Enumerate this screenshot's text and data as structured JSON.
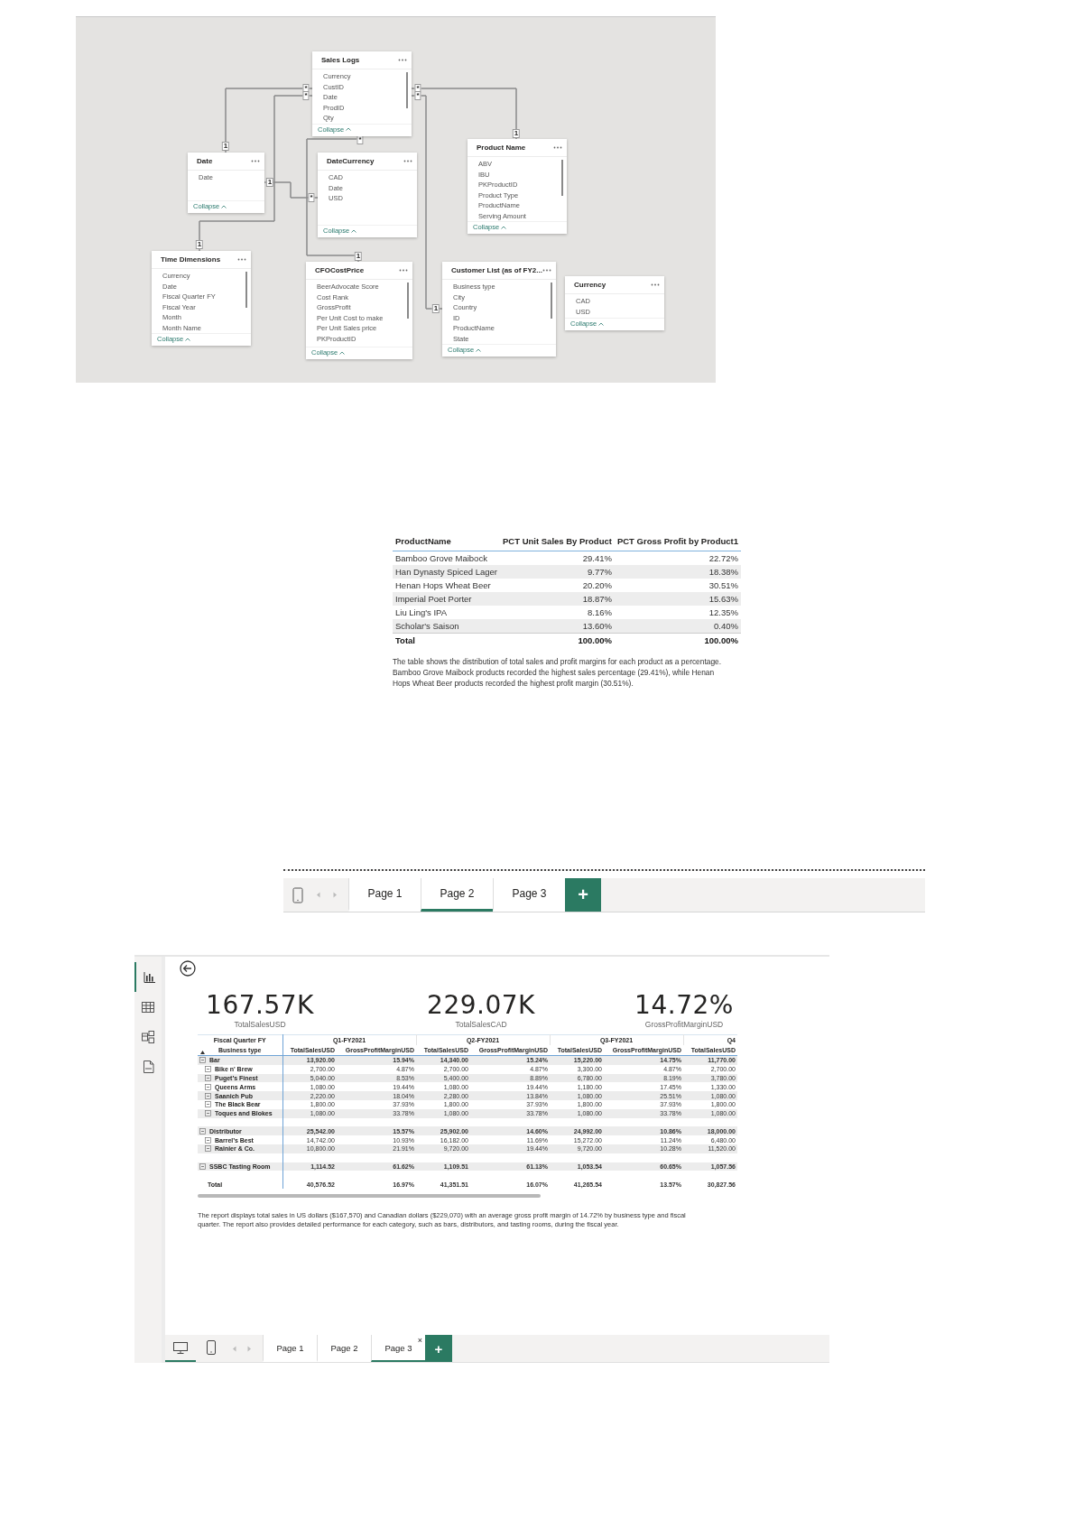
{
  "model_diagram": {
    "tables": [
      {
        "name": "Sales Logs",
        "fields": [
          "Currency",
          "CustID",
          "Date",
          "ProdID",
          "Qty"
        ],
        "collapse_label": "Collapse"
      },
      {
        "name": "Date",
        "fields": [
          "Date"
        ],
        "collapse_label": "Collapse"
      },
      {
        "name": "DateCurrency",
        "fields": [
          "CAD",
          "Date",
          "USD"
        ],
        "collapse_label": "Collapse"
      },
      {
        "name": "Product Name",
        "fields": [
          "ABV",
          "IBU",
          "PKProductID",
          "Product Type",
          "ProductName",
          "Serving Amount"
        ],
        "collapse_label": "Collapse"
      },
      {
        "name": "Time Dimensions",
        "fields": [
          "Currency",
          "Date",
          "Fiscal Quarter FY",
          "Fiscal Year",
          "Month",
          "Month Name"
        ],
        "collapse_label": "Collapse"
      },
      {
        "name": "CFOCostPrice",
        "fields": [
          "BeerAdvocate Score",
          "Cost Rank",
          "GrossProfit",
          "Per Unit Cost to make",
          "Per Unit Sales price",
          "PKProductID"
        ],
        "collapse_label": "Collapse"
      },
      {
        "name": "Customer List (as of FY2...",
        "fields": [
          "Business type",
          "City",
          "Country",
          "ID",
          "ProductName",
          "State"
        ],
        "collapse_label": "Collapse"
      },
      {
        "name": "Currency",
        "fields": [
          "CAD",
          "USD"
        ],
        "collapse_label": "Collapse"
      }
    ],
    "relationships": [
      {
        "one_label": "1",
        "many_label": "*"
      },
      {
        "one_label": "1",
        "many_label": "*"
      },
      {
        "one_label": "1",
        "many_label": "*"
      },
      {
        "one_label": "1",
        "many_label": "*"
      },
      {
        "one_label": "1",
        "many_label": "*"
      },
      {
        "one_label": "1",
        "many_label": "*"
      }
    ]
  },
  "product_table": {
    "columns": [
      "ProductName",
      "PCT Unit Sales By Product",
      "PCT Gross Profit by Product1"
    ],
    "rows": [
      [
        "Bamboo Grove Maibock",
        "29.41%",
        "22.72%"
      ],
      [
        "Han Dynasty Spiced Lager",
        "9.77%",
        "18.38%"
      ],
      [
        "Henan Hops Wheat Beer",
        "20.20%",
        "30.51%"
      ],
      [
        "Imperial Poet Porter",
        "18.87%",
        "15.63%"
      ],
      [
        "Liu Ling's IPA",
        "8.16%",
        "12.35%"
      ],
      [
        "Scholar's Saison",
        "13.60%",
        "0.40%"
      ]
    ],
    "total": [
      "Total",
      "100.00%",
      "100.00%"
    ],
    "caption": "The table shows the distribution of total sales and profit margins for each product as a percentage. Bamboo Grove Maibock products recorded the highest sales percentage (29.41%), while Henan Hops Wheat Beer products recorded the highest profit margin (30.51%)."
  },
  "page_tabs_top": {
    "tabs": [
      {
        "label": "Page 1",
        "selected": false
      },
      {
        "label": "Page 2",
        "selected": true
      },
      {
        "label": "Page 3",
        "selected": false
      }
    ],
    "add_label": "+"
  },
  "report": {
    "kpis": [
      {
        "value": "167.57K",
        "label": "TotalSalesUSD"
      },
      {
        "value": "229.07K",
        "label": "TotalSalesCAD"
      },
      {
        "value": "14.72%",
        "label": "GrossProfitMarginUSD"
      }
    ],
    "matrix": {
      "corner_top": "Fiscal Quarter FY",
      "corner_bottom": "Business type",
      "quarters": [
        "Q1-FY2021",
        "Q2-FY2021",
        "Q3-FY2021",
        "Q4"
      ],
      "measures": [
        "TotalSalesUSD",
        "GrossProfitMarginUSD",
        "TotalSalesUSD",
        "GrossProfitMarginUSD",
        "TotalSalesUSD",
        "GrossProfitMarginUSD",
        "TotalSalesUSD"
      ],
      "rows": [
        {
          "kind": "group",
          "label": "Bar",
          "values": [
            "13,920.00",
            "15.94%",
            "14,340.00",
            "15.24%",
            "15,220.00",
            "14.75%",
            "11,770.00"
          ]
        },
        {
          "kind": "child",
          "label": "Bike n' Brew",
          "values": [
            "2,700.00",
            "4.87%",
            "2,700.00",
            "4.87%",
            "3,300.00",
            "4.87%",
            "2,700.00"
          ]
        },
        {
          "kind": "child",
          "label": "Puget’s Finest",
          "values": [
            "5,040.00",
            "8.53%",
            "5,400.00",
            "8.89%",
            "6,780.00",
            "8.19%",
            "3,780.00"
          ]
        },
        {
          "kind": "child",
          "label": "Queens Arms",
          "values": [
            "1,080.00",
            "19.44%",
            "1,080.00",
            "19.44%",
            "1,180.00",
            "17.45%",
            "1,330.00"
          ]
        },
        {
          "kind": "child",
          "label": "Saanich Pub",
          "values": [
            "2,220.00",
            "18.04%",
            "2,280.00",
            "13.84%",
            "1,080.00",
            "25.51%",
            "1,080.00"
          ]
        },
        {
          "kind": "child",
          "label": "The Black Bear",
          "values": [
            "1,800.00",
            "37.93%",
            "1,800.00",
            "37.93%",
            "1,800.00",
            "37.93%",
            "1,800.00"
          ]
        },
        {
          "kind": "child",
          "label": "Toques and Blokes",
          "values": [
            "1,080.00",
            "33.78%",
            "1,080.00",
            "33.78%",
            "1,080.00",
            "33.78%",
            "1,080.00"
          ]
        },
        {
          "kind": "group",
          "label": "Distributor",
          "values": [
            "25,542.00",
            "15.57%",
            "25,902.00",
            "14.60%",
            "24,992.00",
            "10.86%",
            "18,000.00"
          ]
        },
        {
          "kind": "child",
          "label": "Barrel’s Best",
          "values": [
            "14,742.00",
            "10.93%",
            "16,182.00",
            "11.69%",
            "15,272.00",
            "11.24%",
            "6,480.00"
          ]
        },
        {
          "kind": "child",
          "label": "Rainier & Co.",
          "values": [
            "10,800.00",
            "21.91%",
            "9,720.00",
            "19.44%",
            "9,720.00",
            "10.28%",
            "11,520.00"
          ]
        },
        {
          "kind": "group",
          "label": "SSBC Tasting Room",
          "values": [
            "1,114.52",
            "61.62%",
            "1,109.51",
            "61.13%",
            "1,053.54",
            "60.65%",
            "1,057.56"
          ]
        },
        {
          "kind": "total",
          "label": "Total",
          "values": [
            "40,576.52",
            "16.97%",
            "41,351.51",
            "16.07%",
            "41,265.54",
            "13.57%",
            "30,827.56"
          ]
        }
      ]
    },
    "caption": "The report displays total sales in US dollars ($167,570) and Canadian dollars ($229,070) with an average gross profit margin of 14.72% by business type and fiscal quarter. The report also provides detailed performance for each category, such as bars, distributors, and tasting rooms, during the fiscal year.",
    "views": [
      {
        "kind": "desktop",
        "selected": true
      },
      {
        "kind": "phone",
        "selected": false
      }
    ],
    "page_tabs": {
      "tabs": [
        {
          "label": "Page 1",
          "selected": false
        },
        {
          "label": "Page 2",
          "selected": false
        },
        {
          "label": "Page 3",
          "selected": true,
          "close": "×"
        }
      ],
      "add_label": "+"
    }
  }
}
